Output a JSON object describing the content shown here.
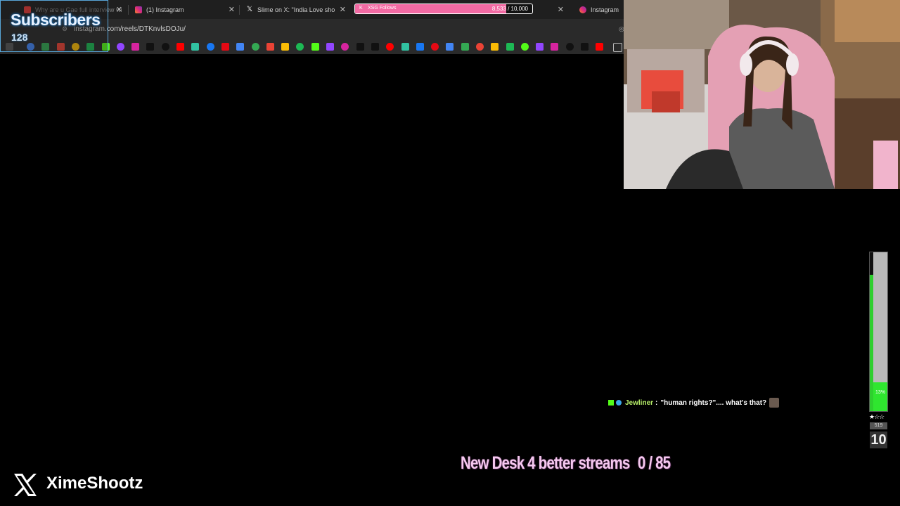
{
  "browser": {
    "tabs": [
      {
        "title": "Why are u Gae full interview wi",
        "favicon_color": "#e53935"
      },
      {
        "title": "(1) Instagram",
        "favicon_color": "#d6249f"
      },
      {
        "title": "Slime on X: \"India Love sho",
        "favicon_color": "#ffffff"
      },
      {
        "title": "Instagram",
        "favicon_color": "#d6249f"
      }
    ],
    "url": "instagram.com/reels/DTKnvlsDOJu/",
    "bookmark_icons": [
      {
        "name": "chrome",
        "color": "#4285f4"
      },
      {
        "name": "maps",
        "color": "#34a853"
      },
      {
        "name": "gmail",
        "color": "#ea4335"
      },
      {
        "name": "photos",
        "color": "#fbbc05"
      },
      {
        "name": "spotify",
        "color": "#1db954"
      },
      {
        "name": "kick",
        "color": "#53fc18"
      },
      {
        "name": "twitch",
        "color": "#9146ff"
      },
      {
        "name": "instagram",
        "color": "#d6249f"
      },
      {
        "name": "x",
        "color": "#111111"
      },
      {
        "name": "tiktok",
        "color": "#111111"
      },
      {
        "name": "youtube",
        "color": "#ff0000"
      },
      {
        "name": "streamlabs",
        "color": "#31c3a2"
      },
      {
        "name": "facebook",
        "color": "#1877f2"
      },
      {
        "name": "netflix",
        "color": "#e50914"
      }
    ]
  },
  "overlay": {
    "subscribers_label": "Subscribers",
    "subscribers_count": "128",
    "follow_goal": {
      "label": "XSG Follows",
      "count_text": "8,533 / 10,000",
      "progress": 0.853,
      "color": "#f26aa3"
    },
    "chat": {
      "user": "Jewliner",
      "separator": ":",
      "message": "\"human rights?\".... what's that?"
    },
    "meter": {
      "percent_label": "13%",
      "level": 0.18,
      "side_level": 0.86,
      "stars": "★☆☆",
      "small_value": "519",
      "big_value": "10"
    },
    "desk_goal": {
      "text": "New Desk 4 better streams",
      "count": "0 / 85"
    },
    "social_handle": "XimeShootz"
  }
}
